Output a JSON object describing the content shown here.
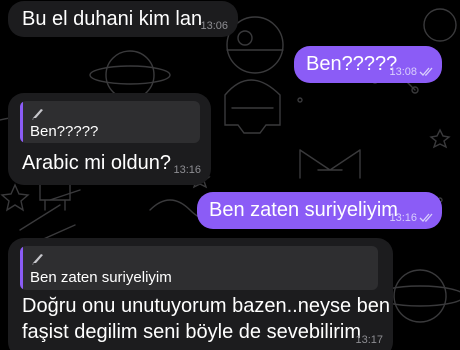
{
  "messages": [
    {
      "text": "Bu el duhani kim lan",
      "time": "13:06"
    },
    {
      "text": "Ben?????",
      "time": "13:08"
    },
    {
      "reply_to": "Ben?????",
      "text": "Arabic mi oldun?",
      "time": "13:16"
    },
    {
      "text": "Ben zaten suriyeliyim",
      "time": "13:16"
    },
    {
      "reply_to": "Ben zaten suriyeliyim",
      "text_lines": [
        "Doğru onu unutuyorum bazen..neyse ben",
        "faşist degilim seni böyle de sevebilirim"
      ],
      "time": "13:17"
    }
  ],
  "icons": {
    "reply_preview": "knife-icon",
    "read_receipt": "double-check-icon",
    "wallpaper": "space-doodle-pattern"
  },
  "colors": {
    "outgoing": "#8b5cf6",
    "incoming": "#1c1c1e",
    "reply_bar": "#8b5cf6",
    "background": "#000000"
  }
}
